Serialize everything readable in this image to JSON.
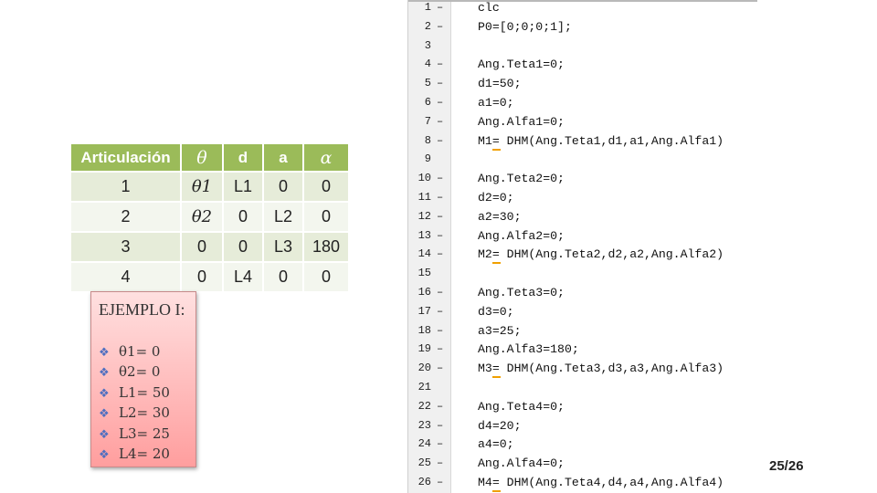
{
  "table": {
    "headers": [
      "Articulación",
      "θ",
      "d",
      "a",
      "α"
    ],
    "rows": [
      [
        "1",
        "θ1",
        "L1",
        "0",
        "0"
      ],
      [
        "2",
        "θ2",
        "0",
        "L2",
        "0"
      ],
      [
        "3",
        "0",
        "0",
        "L3",
        "180"
      ],
      [
        "4",
        "0",
        "L4",
        "0",
        "0"
      ]
    ]
  },
  "example": {
    "title": "EJEMPLO I:",
    "items": [
      "θ1= 0",
      "θ2= 0",
      "L1= 50",
      "L2= 30",
      "L3= 25",
      "L4= 20"
    ]
  },
  "code": {
    "lines": [
      {
        "n": "1",
        "dash": "–",
        "text": "clc"
      },
      {
        "n": "2",
        "dash": "–",
        "text": "P0=[0;0;0;1];"
      },
      {
        "n": "3",
        "dash": "",
        "text": ""
      },
      {
        "n": "4",
        "dash": "–",
        "text": "Ang.Teta1=0;"
      },
      {
        "n": "5",
        "dash": "–",
        "text": "d1=50;"
      },
      {
        "n": "6",
        "dash": "–",
        "text": "a1=0;"
      },
      {
        "n": "7",
        "dash": "–",
        "text": "Ang.Alfa1=0;"
      },
      {
        "n": "8",
        "dash": "–",
        "text": "M1= DHM(Ang.Teta1,d1,a1,Ang.Alfa1)"
      },
      {
        "n": "9",
        "dash": "",
        "text": ""
      },
      {
        "n": "10",
        "dash": "–",
        "text": "Ang.Teta2=0;"
      },
      {
        "n": "11",
        "dash": "–",
        "text": "d2=0;"
      },
      {
        "n": "12",
        "dash": "–",
        "text": "a2=30;"
      },
      {
        "n": "13",
        "dash": "–",
        "text": "Ang.Alfa2=0;"
      },
      {
        "n": "14",
        "dash": "–",
        "text": "M2= DHM(Ang.Teta2,d2,a2,Ang.Alfa2)"
      },
      {
        "n": "15",
        "dash": "",
        "text": ""
      },
      {
        "n": "16",
        "dash": "–",
        "text": "Ang.Teta3=0;"
      },
      {
        "n": "17",
        "dash": "–",
        "text": "d3=0;"
      },
      {
        "n": "18",
        "dash": "–",
        "text": "a3=25;"
      },
      {
        "n": "19",
        "dash": "–",
        "text": "Ang.Alfa3=180;"
      },
      {
        "n": "20",
        "dash": "–",
        "text": "M3= DHM(Ang.Teta3,d3,a3,Ang.Alfa3)"
      },
      {
        "n": "21",
        "dash": "",
        "text": ""
      },
      {
        "n": "22",
        "dash": "–",
        "text": "Ang.Teta4=0;"
      },
      {
        "n": "23",
        "dash": "–",
        "text": "d4=20;"
      },
      {
        "n": "24",
        "dash": "–",
        "text": "a4=0;"
      },
      {
        "n": "25",
        "dash": "–",
        "text": "Ang.Alfa4=0;"
      },
      {
        "n": "26",
        "dash": "–",
        "text": "M4= DHM(Ang.Teta4,d4,a4,Ang.Alfa4)"
      }
    ],
    "warning_color": "#f0a000"
  },
  "page_number": "25/26",
  "colors": {
    "table_header": "#9bbb59",
    "table_row_odd": "#e6ecd9",
    "table_row_even": "#f3f6ee",
    "example_bg_top": "#ffe0e0",
    "example_bg_bottom": "#ff9e9e",
    "bullet": "#4f6fc0"
  }
}
